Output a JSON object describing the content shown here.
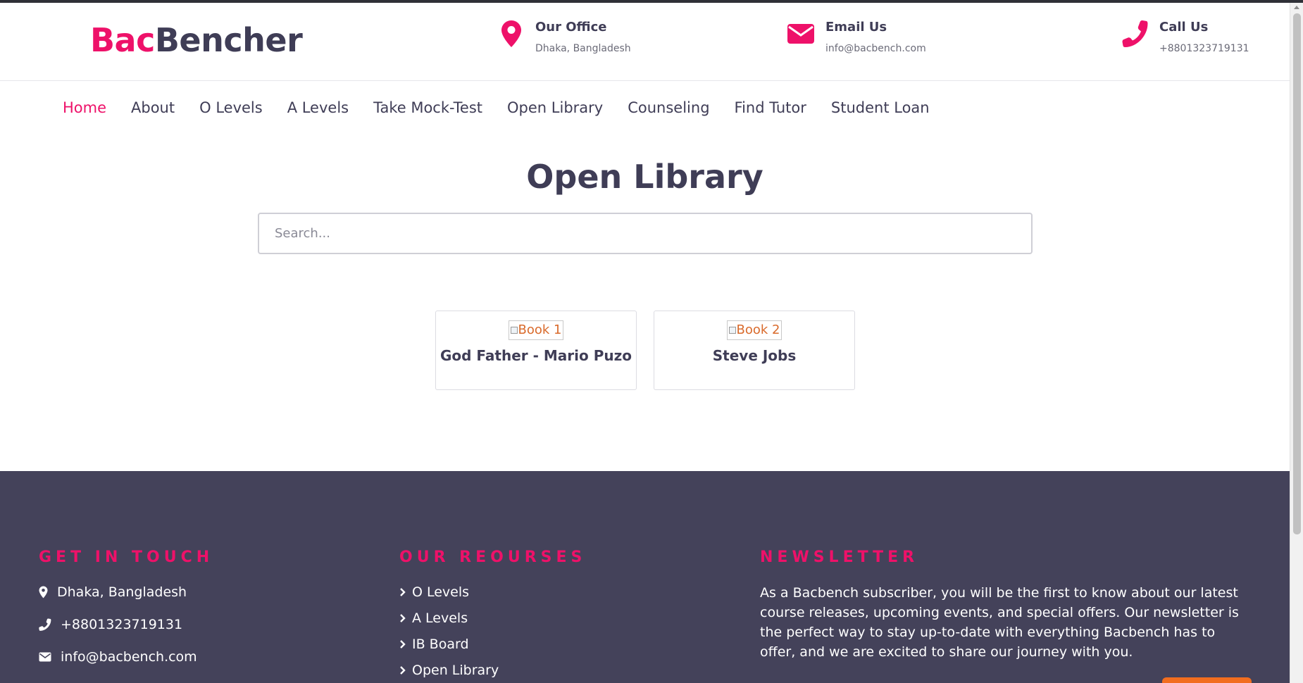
{
  "header": {
    "logo": {
      "part1": "Bac",
      "part2": "Bencher"
    },
    "office": {
      "title": "Our Office",
      "value": "Dhaka, Bangladesh",
      "icon": "map-pin-icon"
    },
    "email": {
      "title": "Email Us",
      "value": "info@bacbench.com",
      "icon": "envelope-icon"
    },
    "call": {
      "title": "Call Us",
      "value": "+8801323719131",
      "icon": "phone-icon"
    }
  },
  "nav": {
    "items": [
      {
        "label": "Home",
        "active": true
      },
      {
        "label": "About"
      },
      {
        "label": "O Levels"
      },
      {
        "label": "A Levels"
      },
      {
        "label": "Take Mock-Test"
      },
      {
        "label": "Open Library"
      },
      {
        "label": "Counseling"
      },
      {
        "label": "Find Tutor"
      },
      {
        "label": "Student Loan"
      }
    ]
  },
  "main": {
    "title": "Open Library",
    "search": {
      "placeholder": "Search...",
      "value": ""
    },
    "books": [
      {
        "alt": "Book 1",
        "title": "God Father - Mario Puzo"
      },
      {
        "alt": "Book 2",
        "title": "Steve Jobs"
      }
    ]
  },
  "footer": {
    "contact": {
      "heading": "GET IN TOUCH",
      "address": "Dhaka, Bangladesh",
      "phone": "+8801323719131",
      "email": "info@bacbench.com"
    },
    "resources": {
      "heading": "OUR REOURSES",
      "links": [
        "O Levels",
        "A Levels",
        "IB Board",
        "Open Library"
      ]
    },
    "newsletter": {
      "heading": "NEWSLETTER",
      "text": "As a Bacbench subscriber, you will be the first to know about our latest course releases, upcoming events, and special offers. Our newsletter is the perfect way to stay up-to-date with everything Bacbench has to offer, and we are excited to share our journey with you."
    }
  },
  "colors": {
    "accent": "#ee1169",
    "dark": "#3f3d56",
    "footer_bg": "#44425a",
    "button_orange": "#f26d1f"
  }
}
